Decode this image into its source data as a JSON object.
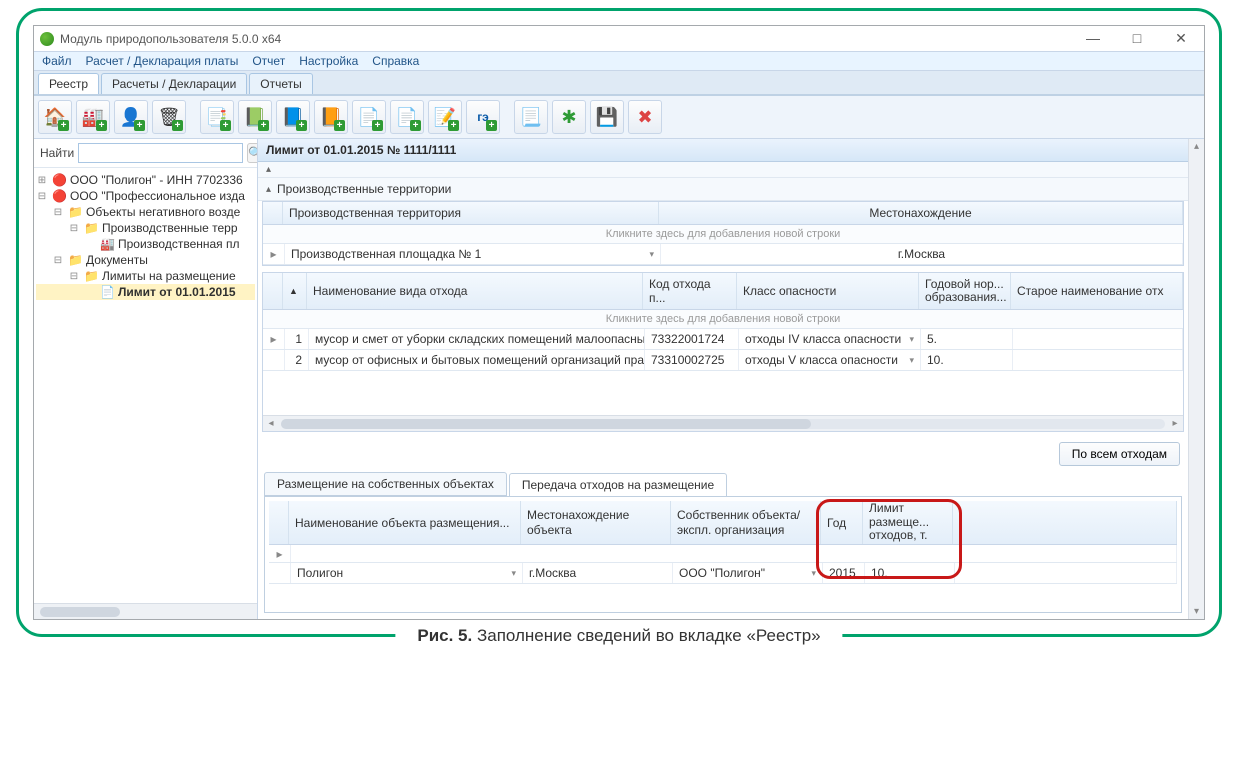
{
  "app": {
    "title": "Модуль природопользователя 5.0.0 x64",
    "window_minimize": "—",
    "window_maximize": "□",
    "window_close": "✕"
  },
  "menu": {
    "file": "Файл",
    "calc": "Расчет / Декларация платы",
    "report": "Отчет",
    "settings": "Настройка",
    "help": "Справка"
  },
  "topTabs": {
    "t1": "Реестр",
    "t2": "Расчеты / Декларации",
    "t3": "Отчеты"
  },
  "toolbar_icons": {
    "i1": "🏠",
    "i2": "🏭",
    "i3": "👤",
    "i4": "🗑",
    "i5": "📑",
    "i6": "📗",
    "i7": "📘",
    "i8": "📙",
    "i9": "📄",
    "i10": "📄",
    "i11": "📝",
    "i12": "гэ",
    "i13": "📃",
    "i14": "✱",
    "i15": "💾",
    "i16": "✖"
  },
  "find": {
    "label": "Найти",
    "value": ""
  },
  "tree": {
    "n1": "ООО \"Полигон\" - ИНН 7702336",
    "n2": "ООО \"Профессиональное изда",
    "n3": "Объекты негативного возде",
    "n4": "Производственные терр",
    "n5": "Производственная пл",
    "n6": "Документы",
    "n7": "Лимиты на размещение",
    "n8": "Лимит от 01.01.2015"
  },
  "content": {
    "header": "Лимит от 01.01.2015 № 1111/1111",
    "section1": "Производственные территории"
  },
  "grid1": {
    "h1": "Производственная территория",
    "h2": "Местонахождение",
    "click_hint": "Кликните здесь для добавления новой строки",
    "r1c1": "Производственная площадка № 1",
    "r1c2": "г.Москва"
  },
  "grid2": {
    "h_num": "",
    "h_name": "Наименование вида отхода",
    "h_code": "Код отхода п...",
    "h_class": "Класс опасности",
    "h_year": "Годовой нор... образования...",
    "h_old": "Старое наименование отх",
    "click_hint": "Кликните здесь для добавления новой строки",
    "rows": [
      {
        "n": "1",
        "name": "мусор и смет от уборки складских помещений малоопасный",
        "code": "73322001724",
        "class": "отходы IV класса опасности",
        "year": "5."
      },
      {
        "n": "2",
        "name": "мусор от офисных и бытовых помещений организаций практиче...",
        "code": "73310002725",
        "class": "отходы V класса опасности",
        "year": "10."
      }
    ]
  },
  "btn_all_waste": "По всем отходам",
  "innerTabs": {
    "t1": "Размещение на собственных объектах",
    "t2": "Передача отходов на размещение"
  },
  "grid3": {
    "h_name": "Наименование объекта размещения...",
    "h_loc": "Местонахождение объекта",
    "h_owner": "Собственник объекта/экспл. организация",
    "h_year": "Год",
    "h_limit": "Лимит размеще... отходов, т.",
    "rows": [
      {
        "name": "Полигон",
        "loc": "г.Москва",
        "owner": "ООО \"Полигон\"",
        "year": "2015",
        "limit": "10."
      }
    ]
  },
  "caption": {
    "prefix": "Рис. 5.",
    "text": " Заполнение сведений во вкладке «Реестр»"
  }
}
